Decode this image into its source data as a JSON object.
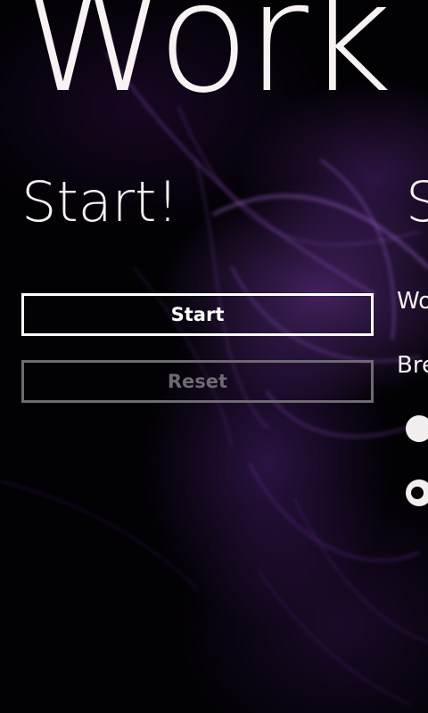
{
  "panorama": {
    "title": "Work"
  },
  "start_section": {
    "header": "Start!",
    "start_button_label": "Start",
    "reset_button_label": "Reset",
    "reset_enabled": false
  },
  "settings_section": {
    "header": "S",
    "work_label": "Wo",
    "break_label": "Bre",
    "options": [
      {
        "selected": false
      },
      {
        "selected": true
      }
    ]
  },
  "theme": {
    "background": "#000000",
    "foreground": "#f8f2f2",
    "disabled": "#6e6a72",
    "accent_glow": "#7a3fb0"
  }
}
